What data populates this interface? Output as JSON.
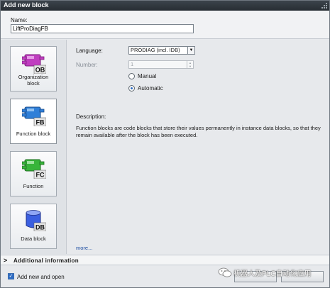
{
  "dialog": {
    "title": "Add new block"
  },
  "name": {
    "label": "Name:",
    "value": "LiftProDiagFB"
  },
  "blocks": [
    {
      "badge": "OB",
      "label": "Organization block"
    },
    {
      "badge": "FB",
      "label": "Function block"
    },
    {
      "badge": "FC",
      "label": "Function"
    },
    {
      "badge": "DB",
      "label": "Data block"
    }
  ],
  "selected_block": "Function block",
  "fields": {
    "language_label": "Language:",
    "language_value": "PRODIAG (incl. IDB)",
    "number_label": "Number:",
    "number_value": "1",
    "manual_label": "Manual",
    "automatic_label": "Automatic",
    "numbering_mode": "Automatic"
  },
  "description": {
    "title": "Description:",
    "text": "Function blocks are code blocks that store their values permanently in instance data blocks, so that they remain available after the block has been executed."
  },
  "more_link": "more...",
  "additional_info": {
    "chevron": ">",
    "label": "Additional  information"
  },
  "footer": {
    "add_new_label": "Add new and open",
    "add_new_checked": true
  },
  "watermark": {
    "text": "机器人及PLC自动化应用"
  },
  "colors": {
    "titlebar": "#2e353b",
    "ob_icon": "#c03ec0",
    "fb_icon": "#2f7fd8",
    "fc_icon": "#37b53a",
    "db_icon": "#3b5fe0",
    "accent": "#2f6dc4"
  }
}
